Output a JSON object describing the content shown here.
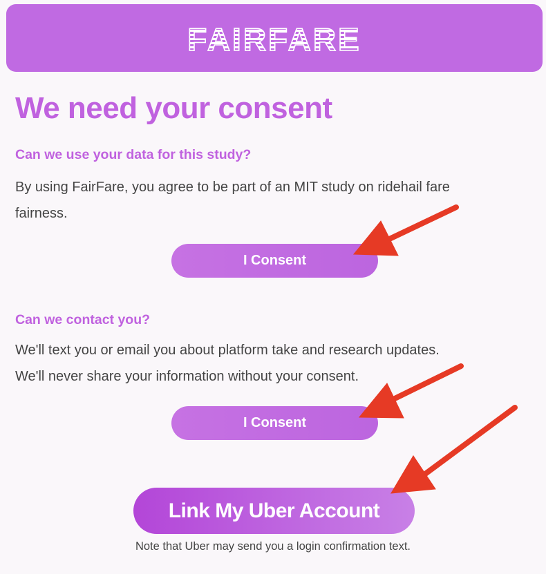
{
  "header": {
    "logo_text": "FAIRFARE",
    "bg_color": "#c06ae2"
  },
  "title": "We need your consent",
  "section1": {
    "heading": "Can we use your data for this study?",
    "line1": "By using FairFare, you agree to be part of an MIT study on ridehail fare",
    "line2": "fairness.",
    "button_label": "I Consent"
  },
  "section2": {
    "heading": "Can we contact you?",
    "line1": "We'll text you or email you about platform take and research updates.",
    "line2": "We'll never share your information without your consent.",
    "button_label": "I Consent"
  },
  "link_button_label": "Link My Uber Account",
  "note": "Note that Uber may send you a login confirmation text.",
  "colors": {
    "accent": "#c062df",
    "button": "#c06ae2",
    "arrow": "#e63a25",
    "text": "#444444",
    "background": "#faf7fa"
  },
  "icons": [
    "red-arrow-icon",
    "red-arrow-icon",
    "red-arrow-icon"
  ]
}
